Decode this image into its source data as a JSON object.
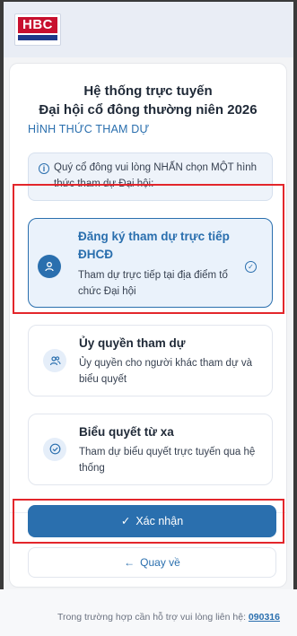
{
  "header": {
    "logo_text": "HBC"
  },
  "card": {
    "title_line1": "Hệ thống trực tuyến",
    "title_line2": "Đại hội cổ đông thường niên 2026",
    "section_label": "HÌNH THỨC THAM DỰ",
    "info_text": "Quý cổ đông vui lòng NHẤN chọn MỘT hình thức tham dự Đại hội:",
    "info_icon": "info-icon"
  },
  "options": [
    {
      "title": "Đăng ký tham dự trực tiếp ĐHCĐ",
      "description": "Tham dự trực tiếp tại địa điểm tổ chức Đại hội",
      "icon": "person-icon",
      "selected": true
    },
    {
      "title": "Ủy quyền tham dự",
      "description": "Ủy quyền cho người khác tham dự và biểu quyết",
      "icon": "users-icon",
      "selected": false
    },
    {
      "title": "Biểu quyết từ xa",
      "description": "Tham dự biểu quyết trực tuyến qua hệ thống",
      "icon": "check-circle-icon",
      "selected": false
    }
  ],
  "buttons": {
    "confirm_label": "Xác nhận",
    "back_label": "Quay về"
  },
  "footer": {
    "text": "Trong trường hợp cần hỗ trợ vui lòng liên hệ:",
    "phone": "090316"
  },
  "colors": {
    "accent": "#2a6fae",
    "highlight": "#e3262b",
    "brand_red": "#c8102e"
  }
}
